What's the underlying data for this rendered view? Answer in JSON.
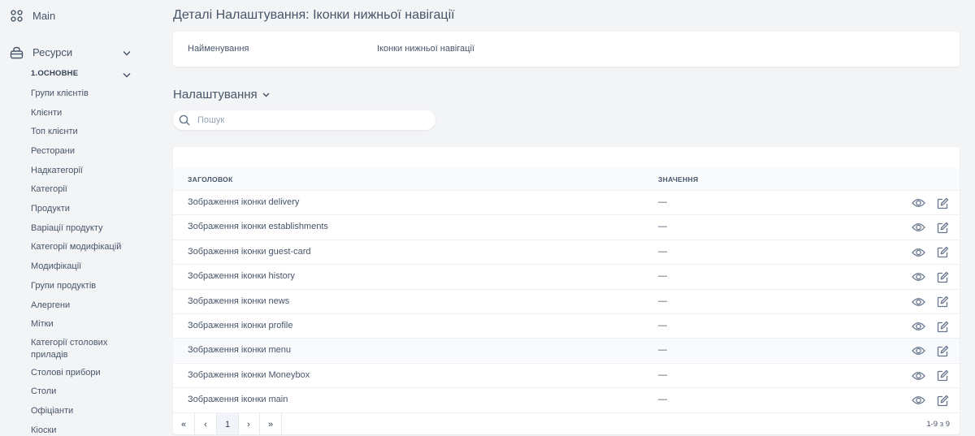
{
  "sidebar": {
    "main_label": "Main",
    "resources_label": "Ресурси",
    "group_title": "1.ОСНОВНЕ",
    "items": [
      "Групи клієнтів",
      "Клієнти",
      "Топ клієнти",
      "Ресторани",
      "Надкатегорії",
      "Категорії",
      "Продукти",
      "Варіації продукту",
      "Категорії модифікацій",
      "Модифікації",
      "Групи продуктів",
      "Алергени",
      "Мітки",
      "Категорії столових приладів",
      "Столові прибори",
      "Столи",
      "Офіціанти",
      "Кіоски"
    ]
  },
  "page": {
    "title": "Деталі Налаштування: Іконки нижньої навігації"
  },
  "detail": {
    "label": "Найменування",
    "value": "Іконки нижньої навігації"
  },
  "settings": {
    "title": "Налаштування",
    "search_placeholder": "Пошук",
    "search_value": "",
    "columns": {
      "title": "ЗАГОЛОВОК",
      "value": "ЗНАЧЕННЯ"
    },
    "rows": [
      {
        "title": "Зображення іконки delivery",
        "value": "—"
      },
      {
        "title": "Зображення іконки establishments",
        "value": "—"
      },
      {
        "title": "Зображення іконки guest-card",
        "value": "—"
      },
      {
        "title": "Зображення іконки history",
        "value": "—"
      },
      {
        "title": "Зображення іконки news",
        "value": "—"
      },
      {
        "title": "Зображення іконки profile",
        "value": "—"
      },
      {
        "title": "Зображення іконки menu",
        "value": "—"
      },
      {
        "title": "Зображення іконки Moneybox",
        "value": "—"
      },
      {
        "title": "Зображення іконки main",
        "value": "—"
      }
    ],
    "highlighted_row": 6,
    "pagination": {
      "first": "«",
      "prev": "‹",
      "current": "1",
      "next": "›",
      "last": "»",
      "info": "1-9 з 9"
    }
  },
  "icons": {
    "main": "grid-icon",
    "resources": "basket-icon",
    "search": "search-icon",
    "view": "eye-icon",
    "edit": "edit-icon",
    "expand": "chevron-down-icon"
  }
}
